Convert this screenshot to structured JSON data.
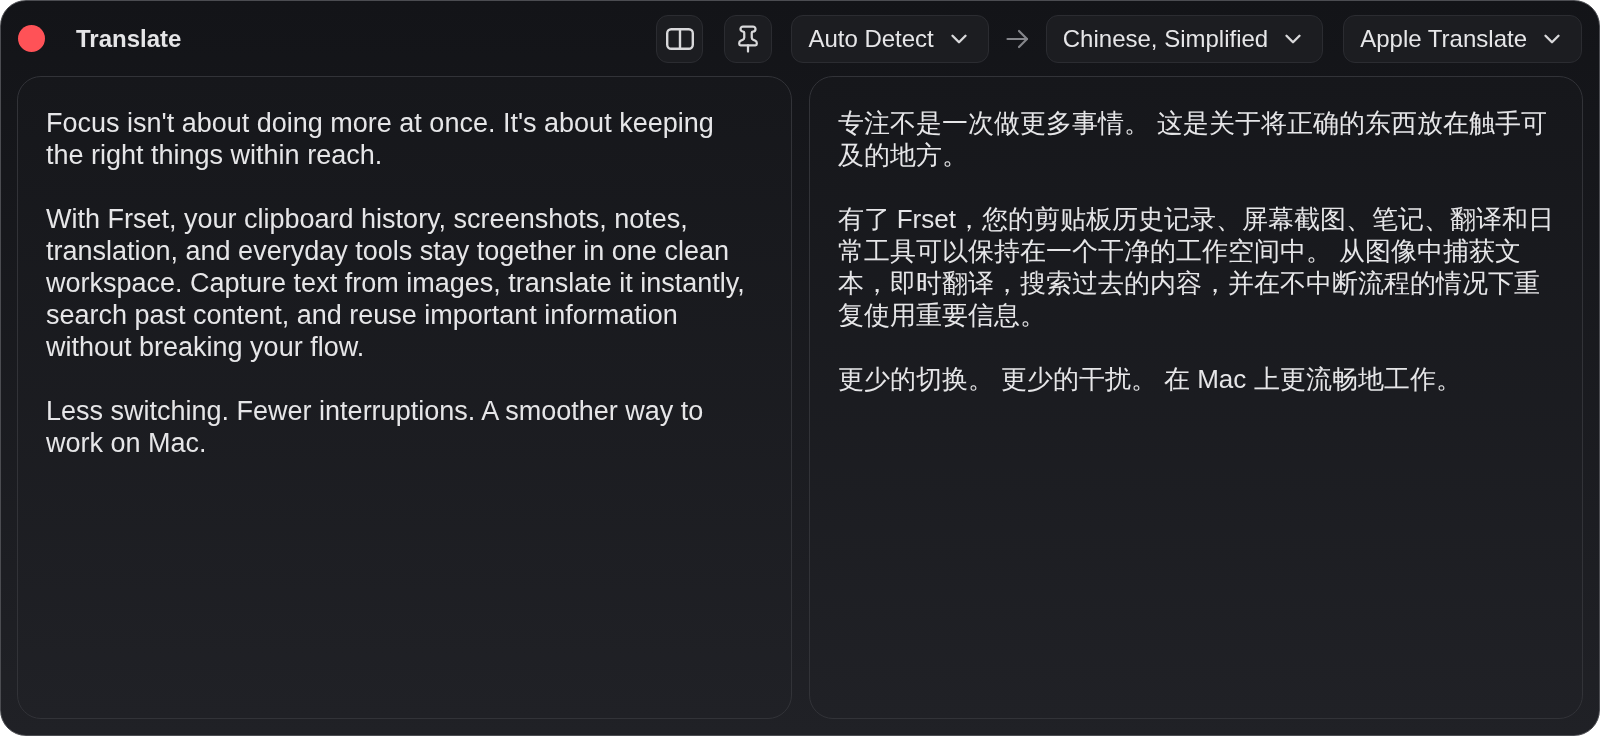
{
  "window": {
    "title": "Translate"
  },
  "toolbar": {
    "source_language": "Auto Detect",
    "target_language": "Chinese, Simplified",
    "engine": "Apple Translate"
  },
  "source": {
    "paragraphs": [
      "Focus isn't about doing more at once. It's about keeping the right things within reach.",
      "With Frset, your clipboard history, screenshots, notes, translation, and everyday tools stay together in one clean workspace. Capture text from images, translate it instantly, search past content, and reuse important information without breaking your flow.",
      "Less switching. Fewer interruptions. A smoother way to work on Mac."
    ]
  },
  "translation": {
    "paragraphs": [
      "专注不是一次做更多事情。 这是关于将正确的东西放在触手可及的地方。",
      "有了 Frset，您的剪贴板历史记录、屏幕截图、笔记、翻译和日常工具可以保持在一个干净的工作空间中。 从图像中捕获文本，即时翻译，搜索过去的内容，并在不中断流程的情况下重复使用重要信息。",
      "更少的切换。 更少的干扰。 在 Mac 上更流畅地工作。"
    ]
  }
}
